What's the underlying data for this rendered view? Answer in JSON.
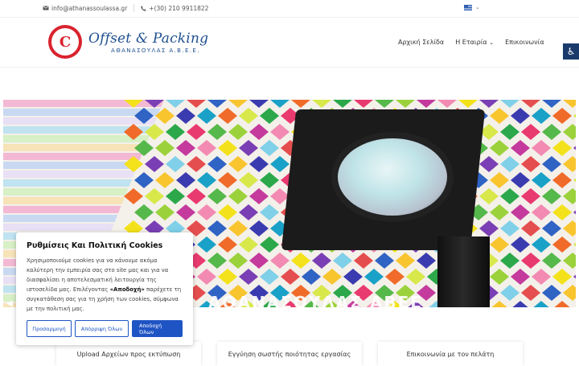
{
  "topbar": {
    "email": "info@athanassoulassa.gr",
    "phone": "+(30) 210 9911822",
    "language_flag": "greek-flag",
    "language_chevron": "⌄"
  },
  "header": {
    "logo_mark": "C",
    "logo_script": "Offset & Packing",
    "logo_sub": "ΑΘΑΝΑΣΟΥΛΑΣ  Α.Β.Ε.Ε.",
    "nav": [
      {
        "label": "Αρχική Σελίδα"
      },
      {
        "label": "Η Εταιρία"
      },
      {
        "label": "Επικοινωνία"
      }
    ],
    "nav_dropdown_icon": "chevron-down"
  },
  "hero": {
    "caption": "ΑΘΑΝΑΣΟΥΛΑΣ ΑΒΕΕ"
  },
  "cookie": {
    "title": "Ρυθμίσεις Και Πολιτική Cookies",
    "body_1": "Χρησιμοποιούμε cookies για να κάνουμε ακόμα καλύτερη την εμπειρία σας στο site μας και για να διασφαλίσει η αποτελεσματική λειτουργία της ιστοσελίδα μας. Επιλέγοντας ",
    "body_bold": "«Αποδοχή»",
    "body_2": " παρέχετε τη συγκατάθεση σας για τη χρήση των cookies, σύμφωνα με την πολιτική μας.",
    "btn_customize": "Προσαρμογή",
    "btn_reject": "Απόρριψη Όλων",
    "btn_accept": "Αποδοχή Όλων"
  },
  "features": [
    {
      "label": "Upload Αρχείων προς εκτύπωση"
    },
    {
      "label": "Εγγύηση σωστής ποιότητας εργασίας"
    },
    {
      "label": "Επικοινωνία με τον πελάτη"
    }
  ],
  "colors": {
    "brand_red": "#d9232e",
    "brand_blue": "#1f4f8f",
    "button_blue": "#1f54c4",
    "accessibility_bg": "#1a3a6b"
  }
}
